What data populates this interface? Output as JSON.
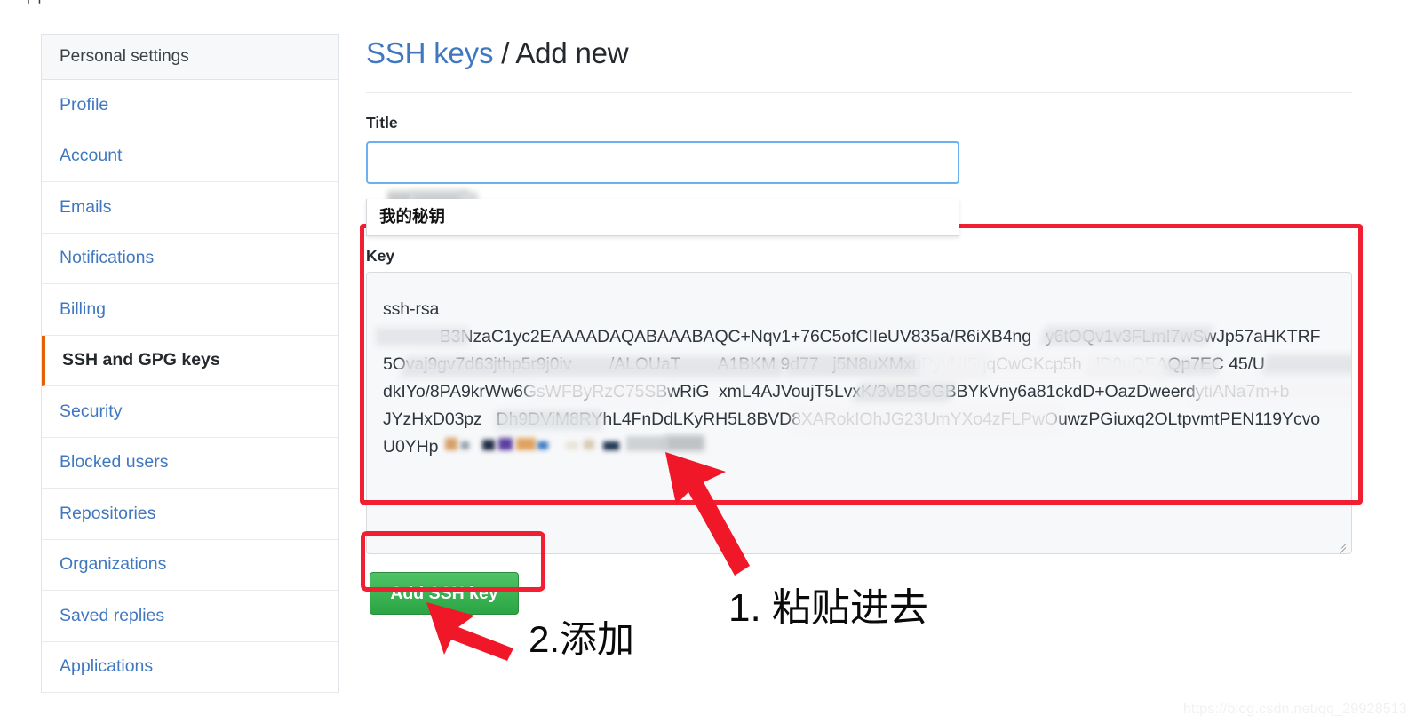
{
  "top_strip": {
    "text": "—  ╷╷   ⌐"
  },
  "sidebar": {
    "header": "Personal settings",
    "items": [
      {
        "label": "Profile",
        "selected": false
      },
      {
        "label": "Account",
        "selected": false
      },
      {
        "label": "Emails",
        "selected": false
      },
      {
        "label": "Notifications",
        "selected": false
      },
      {
        "label": "Billing",
        "selected": false
      },
      {
        "label": "SSH and GPG keys",
        "selected": true
      },
      {
        "label": "Security",
        "selected": false
      },
      {
        "label": "Blocked users",
        "selected": false
      },
      {
        "label": "Repositories",
        "selected": false
      },
      {
        "label": "Organizations",
        "selected": false
      },
      {
        "label": "Saved replies",
        "selected": false
      },
      {
        "label": "Applications",
        "selected": false
      }
    ]
  },
  "main": {
    "title_link": "SSH keys",
    "title_rest": " / Add new",
    "title_field": {
      "label": "Title",
      "value": "",
      "placeholder": ""
    },
    "autocomplete": {
      "options": [
        "我的秘钥"
      ]
    },
    "key_field": {
      "label": "Key",
      "line1": "ssh-rsa",
      "line2": "            B3NzaC1yc2EAAAADAQABAAABAQC+Nqv1+76C5ofCIIeUV835a/R6iXB4ng   y6tOQv1v3FLmI7wSwJp57aHKTRF",
      "line3": "5Ovaj9gv7d63jthp5r9j0iv        /ALOUaT        A1BKM 9d77   j5N8uXMxuPyvNt5qqCwCKcp5h   lD0uQEAQp7EC 45/U",
      "line4": "dkIYo/8PA9krWw6GsWFByRzC75SBwRiG  xmL4AJVoujT5LvxK/3vBBGGBBYkVny6a81ckdD+OazDweerdytiANa7m+b",
      "line5": "JYzHxD03pz   Dh9DViM8RYhL4FnDdLKyRH5L8BVD8XARokIOhJG23UmYXo4zFLPwOuwzPGiuxq2OLtpvmtPEN119Ycvo",
      "line6": "U0YHp"
    },
    "submit_label": "Add SSH key"
  },
  "annotations": [
    {
      "id": "step-1",
      "text": "1. 粘贴进去"
    },
    {
      "id": "step-2",
      "text": "2.添加"
    }
  ],
  "watermark": "https://blog.csdn.net/qq_29928513",
  "colors": {
    "link": "#4078c0",
    "accent_selected": "#e36209",
    "annotation_red": "#f02032",
    "button_green": "#2aa544",
    "focus_blue": "#6cb1ef"
  }
}
